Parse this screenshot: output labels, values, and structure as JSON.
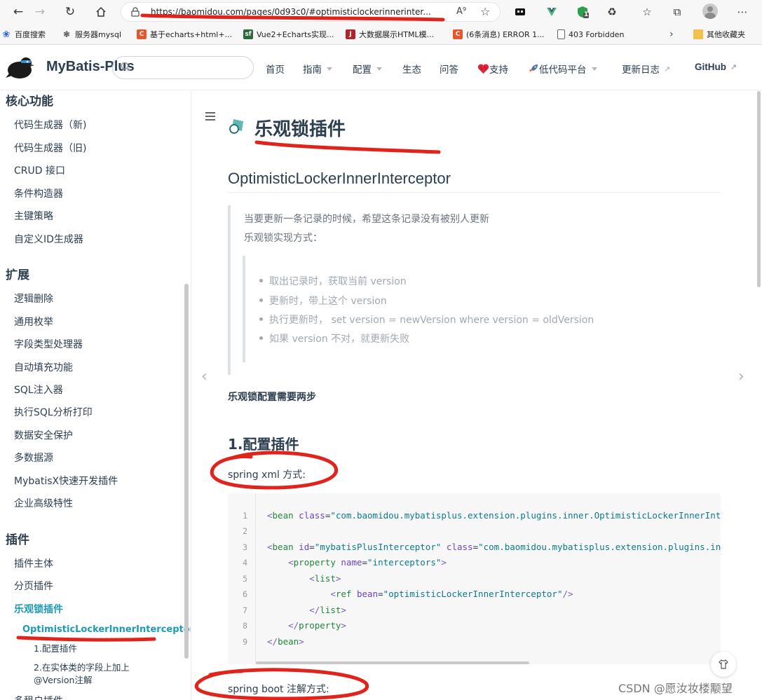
{
  "browser": {
    "url": "https://baomidou.com/pages/0d93c0/#optimisticlockerinnerinter...",
    "icons": {
      "back": "arrow-left-icon",
      "forward": "arrow-right-icon",
      "refresh": "refresh-icon",
      "home": "home-icon",
      "lock": "lock-icon",
      "read_aloud": "read-aloud-icon",
      "favorite": "add-favorite-icon",
      "profile": "profile-icon",
      "more": "more-icon"
    },
    "extension_badge": "1",
    "bookmarks": [
      {
        "label": "百度搜索",
        "color": "#2f5ed8"
      },
      {
        "label": "服务器mysql",
        "color": "#444444"
      },
      {
        "label": "基于echarts+html+...",
        "color": "#e8542b"
      },
      {
        "label": "Vue2+Echarts实现...",
        "color": "#2d6a3a"
      },
      {
        "label": "大数据展示HTML模...",
        "color": "#b0242b"
      },
      {
        "label": "(6条消息) ERROR 1...",
        "color": "#e8542b"
      },
      {
        "label": "403 Forbidden",
        "color": "#666666"
      }
    ],
    "other_bookmarks": "其他收藏夹"
  },
  "site": {
    "title": "MyBatis-Plus",
    "nav": [
      {
        "label": "首页",
        "caret": false,
        "external": false
      },
      {
        "label": "指南",
        "caret": true,
        "external": false
      },
      {
        "label": "配置",
        "caret": true,
        "external": false
      },
      {
        "label": "生态",
        "caret": false,
        "external": false
      },
      {
        "label": "问答",
        "caret": false,
        "external": false
      },
      {
        "label": "支持",
        "caret": false,
        "external": false,
        "icon": "heart-icon"
      },
      {
        "label": "低代码平台",
        "caret": true,
        "external": false,
        "icon": "rocket-icon"
      },
      {
        "label": "更新日志",
        "caret": false,
        "external": true
      },
      {
        "label": "GitHub",
        "caret": false,
        "external": true
      }
    ]
  },
  "sidebar": {
    "groups": [
      {
        "title": "核心功能",
        "items": [
          "代码生成器（新)",
          "代码生成器（旧)",
          "CRUD 接口",
          "条件构造器",
          "主键策略",
          "自定义ID生成器"
        ]
      },
      {
        "title": "扩展",
        "items": [
          "逻辑删除",
          "通用枚举",
          "字段类型处理器",
          "自动填充功能",
          "SQL注入器",
          "执行SQL分析打印",
          "数据安全保护",
          "多数据源",
          "MybatisX快速开发插件",
          "企业高级特性"
        ]
      },
      {
        "title": "插件",
        "items": [
          "插件主体",
          "分页插件",
          "乐观锁插件"
        ]
      }
    ],
    "active_item": "乐观锁插件",
    "active_sub": "OptimisticLockerInnerInterceptor",
    "sub_items": [
      "1.配置插件",
      "2.在实体类的字段上加上",
      "@Version注解"
    ],
    "cut_item": "多租户插件"
  },
  "content": {
    "title": "乐观锁插件",
    "h2": "OptimisticLockerInnerInterceptor",
    "quote_lines": [
      "当要更新一条记录的时候，希望这条记录没有被别人更新",
      "乐观锁实现方式："
    ],
    "quote_items": [
      "取出记录时，获取当前 version",
      "更新时，带上这个 version",
      "执行更新时， set version = newVersion where version = oldVersion",
      "如果 version 不对，就更新失败"
    ],
    "strong": "乐观锁配置需要两步",
    "h3": "1.配置插件",
    "p_xml": "spring xml 方式:",
    "p_boot": "spring boot 注解方式:",
    "code_line_numbers": [
      "1",
      "2",
      "3",
      "4",
      "5",
      "6",
      "7",
      "8",
      "9"
    ],
    "code": {
      "l1_tag": "bean",
      "l1_attr": "class",
      "l1_val": "\"com.baomidou.mybatisplus.extension.plugins.inner.OptimisticLockerInnerInterceptor\"",
      "l3_tag": "bean",
      "l3_attr1": "id",
      "l3_val1": "\"mybatisPlusInterceptor\"",
      "l3_attr2": "class",
      "l3_val2": "\"com.baomidou.mybatisplus.extension.plugins.inner.MybatisPlusInterceptor\"",
      "l4_tag": "property",
      "l4_attr": "name",
      "l4_val": "\"interceptors\"",
      "l5_tag": "list",
      "l6_tag": "ref",
      "l6_attr": "bean",
      "l6_val": "\"optimisticLockerInnerInterceptor\"",
      "l7_tag": "list",
      "l8_tag": "property",
      "l9_tag": "bean"
    }
  },
  "watermark": "CSDN @愿汝妆楼颙望",
  "annotation_color": "#e0241b"
}
